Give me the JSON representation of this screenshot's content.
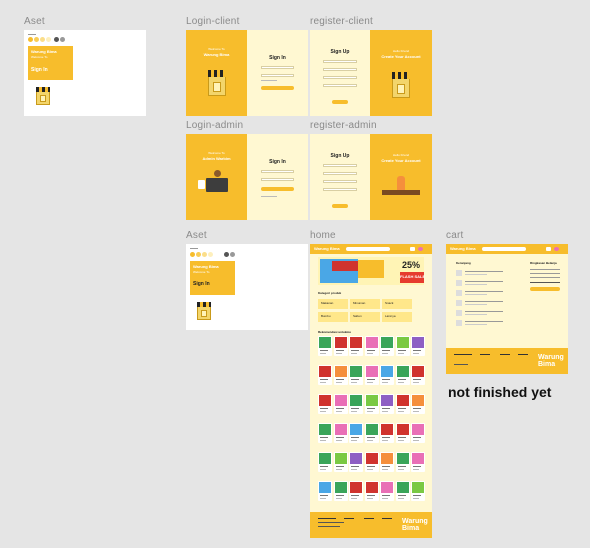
{
  "frames": {
    "aset_1": "Aset",
    "login_client": "Login-client",
    "register_client": "register-client",
    "login_admin": "Login-admin",
    "register_admin": "register-admin",
    "aset_2": "Aset",
    "home": "home",
    "cart": "cart"
  },
  "brand": {
    "title_line1": "Warung Bima",
    "title_line2": "Welcome To",
    "login_welcome": "Welcome To",
    "login_brand": "Warung Bima",
    "admin_welcome": "Welcome To",
    "admin_brand": "Admin Warbim",
    "register_hello": "Hello Friend",
    "register_tagline": "Create Your Account",
    "footer_brand_line1": "Warung",
    "footer_brand_line2": "Bima"
  },
  "forms": {
    "sign_in": "Sign In",
    "sign_up": "Sign Up"
  },
  "home": {
    "nav_brand": "Warung Bima",
    "promo_percent": "25%",
    "promo_label": "FLASH SALE",
    "section_categories": "Kategori produk",
    "section_recommended": "Rekomendasi untukmu",
    "categories": [
      "Makanan",
      "Minuman",
      "Snack",
      "Bumbu",
      "Sabun",
      "Lainnya"
    ]
  },
  "cart": {
    "nav_brand": "Warung Bima",
    "left_title": "Keranjang",
    "right_title": "Ringkasan Belanja"
  },
  "note": "not finished yet",
  "colors": {
    "yellow": "#f7bd2c",
    "cream": "#fff8d2",
    "canvas": "#e5e5e5"
  }
}
